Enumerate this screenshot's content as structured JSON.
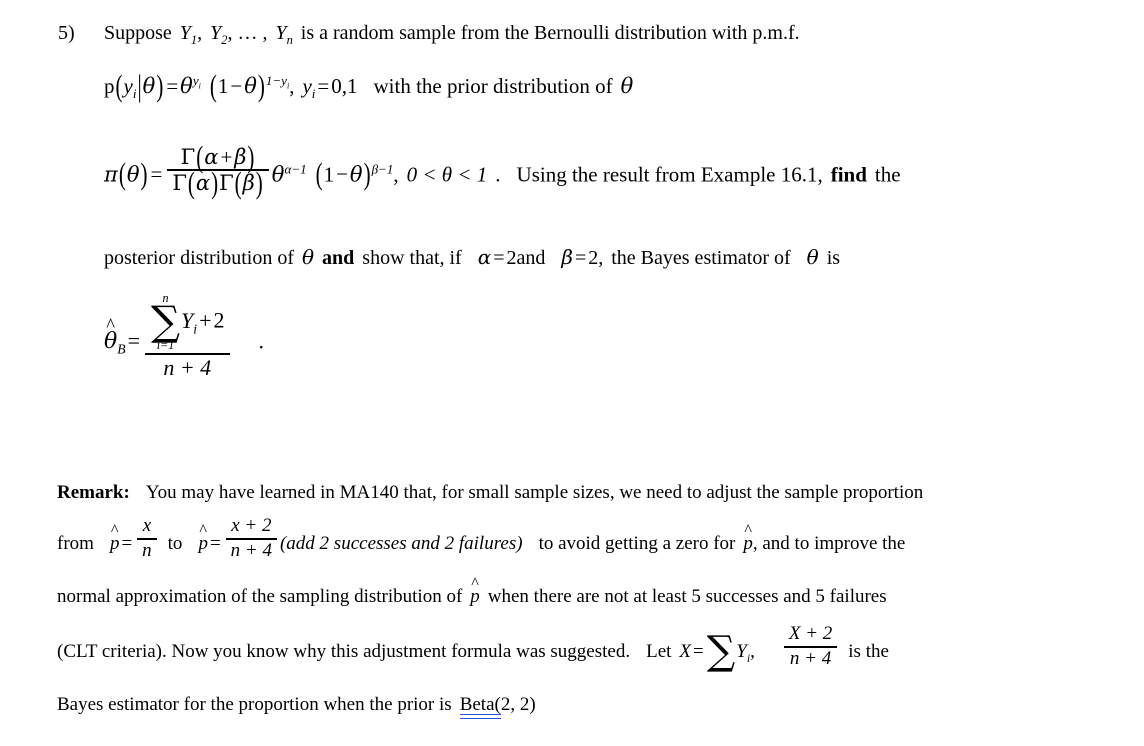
{
  "document": {
    "type": "statistics-homework-problem",
    "problem_number": "5)",
    "background_color": "#ffffff",
    "text_color": "#000000",
    "spellcheck_underline_color": "#2a4fd6"
  },
  "problem": {
    "intro": {
      "lead": "Suppose",
      "var1": "Y",
      "sub1": "1",
      "comma1": ",",
      "var2": "Y",
      "sub2": "2",
      "ellipsis": ", … ,",
      "var3": "Y",
      "sub3": "n",
      "tail": "is a random sample from the Bernoulli distribution with p.m.f."
    },
    "pmf": {
      "p": "p",
      "open": "(",
      "y": "y",
      "yi": "i",
      "bar": "|",
      "theta": "θ",
      "close": ")",
      "eq": "=",
      "theta2": "θ",
      "exp1_y": "y",
      "exp1_i": "i",
      "one": "1",
      "minus": "−",
      "theta3": "θ",
      "exp2": "1−y",
      "exp2_i": "i",
      "comma": ",",
      "y2": "y",
      "y2i": "i",
      "eq2": "=",
      "values": "0,1",
      "tail": "with the prior distribution of",
      "theta4": "θ"
    },
    "prior": {
      "pi": "π",
      "theta": "θ",
      "eq": "=",
      "numerator": "Γ(α + β)",
      "denominator": "Γ(α)Γ(β)",
      "gamma": "Γ",
      "alpha": "α",
      "beta": "β",
      "plus": "+",
      "theta_base": "θ",
      "exp_alpha": "α−1",
      "one": "1",
      "minus": "−",
      "exp_beta": "β−1",
      "comma": ",",
      "range": "0 < θ < 1",
      "period": ".",
      "tail_pre": "Using the result from Example 16.1,",
      "tail_bold": "find",
      "tail_post": "the"
    },
    "posterior": {
      "pre": "posterior distribution of",
      "theta": "θ",
      "bold_and": "and",
      "mid": "show that, if",
      "alpha": "α",
      "eq1": "=",
      "val1": "2",
      "and_word": "and",
      "beta": "β",
      "eq2": "=",
      "val2": "2,",
      "tail": "the Bayes estimator of",
      "theta2": "θ",
      "is": "is"
    },
    "estimator": {
      "theta": "θ",
      "hat": "^",
      "subscript_B": "B",
      "eq": "=",
      "sum_upper": "n",
      "sum_lower": "i=1",
      "sum_symbol": "∑",
      "sum_term": "Y",
      "sum_term_sub": "i",
      "plus": "+",
      "numerator_const": "2",
      "denominator": "n + 4",
      "period": "."
    }
  },
  "remark": {
    "label": "Remark:",
    "line1": "You may have learned in MA140 that, for small sample sizes, we need to adjust the sample proportion",
    "line2": {
      "from": "from",
      "phat": "p",
      "hat": "^",
      "eq1": "=",
      "frac1_num": "x",
      "frac1_den": "n",
      "to": "to",
      "phat2": "p",
      "eq2": "=",
      "frac2_num": "x + 2",
      "frac2_den": "n + 4",
      "italic_note": "(add 2 successes and 2 failures)",
      "tail_pre": "to avoid getting a zero for",
      "phat3": "p",
      "tail_post": ", and to improve the"
    },
    "line3": {
      "pre": "normal approximation of the sampling distribution of",
      "phat": "p",
      "hat": "^",
      "post": "when there are not at least 5 successes and 5 failures"
    },
    "line4": {
      "pre": "(CLT criteria).  Now you know why this adjustment formula was suggested.",
      "let": "Let",
      "X": "X",
      "eq": "=",
      "sum_symbol": "∑",
      "sum_term": "Y",
      "sum_term_sub": "i",
      "comma": ",",
      "frac_num": "X + 2",
      "frac_den": "n + 4",
      "tail": "is the"
    },
    "line5": {
      "pre": "Bayes estimator for the proportion when the prior is",
      "beta_word": "Beta(",
      "beta_args": "2, 2)"
    }
  }
}
